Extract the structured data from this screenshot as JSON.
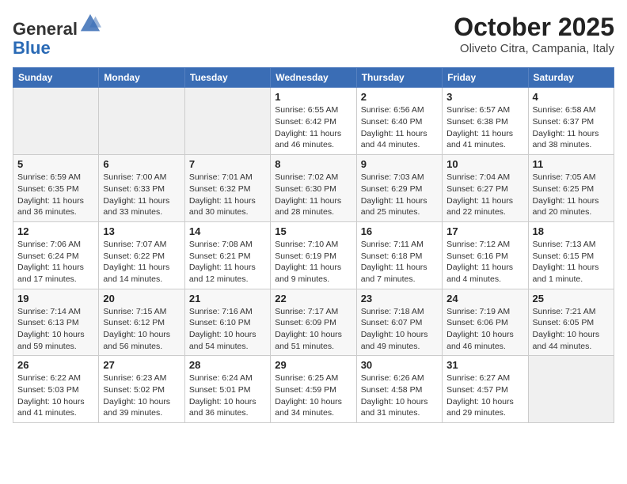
{
  "header": {
    "logo": {
      "general": "General",
      "blue": "Blue",
      "tagline": ""
    },
    "title": "October 2025",
    "location": "Oliveto Citra, Campania, Italy"
  },
  "calendar": {
    "days_of_week": [
      "Sunday",
      "Monday",
      "Tuesday",
      "Wednesday",
      "Thursday",
      "Friday",
      "Saturday"
    ],
    "weeks": [
      [
        {
          "day": "",
          "info": ""
        },
        {
          "day": "",
          "info": ""
        },
        {
          "day": "",
          "info": ""
        },
        {
          "day": "1",
          "info": "Sunrise: 6:55 AM\nSunset: 6:42 PM\nDaylight: 11 hours\nand 46 minutes."
        },
        {
          "day": "2",
          "info": "Sunrise: 6:56 AM\nSunset: 6:40 PM\nDaylight: 11 hours\nand 44 minutes."
        },
        {
          "day": "3",
          "info": "Sunrise: 6:57 AM\nSunset: 6:38 PM\nDaylight: 11 hours\nand 41 minutes."
        },
        {
          "day": "4",
          "info": "Sunrise: 6:58 AM\nSunset: 6:37 PM\nDaylight: 11 hours\nand 38 minutes."
        }
      ],
      [
        {
          "day": "5",
          "info": "Sunrise: 6:59 AM\nSunset: 6:35 PM\nDaylight: 11 hours\nand 36 minutes."
        },
        {
          "day": "6",
          "info": "Sunrise: 7:00 AM\nSunset: 6:33 PM\nDaylight: 11 hours\nand 33 minutes."
        },
        {
          "day": "7",
          "info": "Sunrise: 7:01 AM\nSunset: 6:32 PM\nDaylight: 11 hours\nand 30 minutes."
        },
        {
          "day": "8",
          "info": "Sunrise: 7:02 AM\nSunset: 6:30 PM\nDaylight: 11 hours\nand 28 minutes."
        },
        {
          "day": "9",
          "info": "Sunrise: 7:03 AM\nSunset: 6:29 PM\nDaylight: 11 hours\nand 25 minutes."
        },
        {
          "day": "10",
          "info": "Sunrise: 7:04 AM\nSunset: 6:27 PM\nDaylight: 11 hours\nand 22 minutes."
        },
        {
          "day": "11",
          "info": "Sunrise: 7:05 AM\nSunset: 6:25 PM\nDaylight: 11 hours\nand 20 minutes."
        }
      ],
      [
        {
          "day": "12",
          "info": "Sunrise: 7:06 AM\nSunset: 6:24 PM\nDaylight: 11 hours\nand 17 minutes."
        },
        {
          "day": "13",
          "info": "Sunrise: 7:07 AM\nSunset: 6:22 PM\nDaylight: 11 hours\nand 14 minutes."
        },
        {
          "day": "14",
          "info": "Sunrise: 7:08 AM\nSunset: 6:21 PM\nDaylight: 11 hours\nand 12 minutes."
        },
        {
          "day": "15",
          "info": "Sunrise: 7:10 AM\nSunset: 6:19 PM\nDaylight: 11 hours\nand 9 minutes."
        },
        {
          "day": "16",
          "info": "Sunrise: 7:11 AM\nSunset: 6:18 PM\nDaylight: 11 hours\nand 7 minutes."
        },
        {
          "day": "17",
          "info": "Sunrise: 7:12 AM\nSunset: 6:16 PM\nDaylight: 11 hours\nand 4 minutes."
        },
        {
          "day": "18",
          "info": "Sunrise: 7:13 AM\nSunset: 6:15 PM\nDaylight: 11 hours\nand 1 minute."
        }
      ],
      [
        {
          "day": "19",
          "info": "Sunrise: 7:14 AM\nSunset: 6:13 PM\nDaylight: 10 hours\nand 59 minutes."
        },
        {
          "day": "20",
          "info": "Sunrise: 7:15 AM\nSunset: 6:12 PM\nDaylight: 10 hours\nand 56 minutes."
        },
        {
          "day": "21",
          "info": "Sunrise: 7:16 AM\nSunset: 6:10 PM\nDaylight: 10 hours\nand 54 minutes."
        },
        {
          "day": "22",
          "info": "Sunrise: 7:17 AM\nSunset: 6:09 PM\nDaylight: 10 hours\nand 51 minutes."
        },
        {
          "day": "23",
          "info": "Sunrise: 7:18 AM\nSunset: 6:07 PM\nDaylight: 10 hours\nand 49 minutes."
        },
        {
          "day": "24",
          "info": "Sunrise: 7:19 AM\nSunset: 6:06 PM\nDaylight: 10 hours\nand 46 minutes."
        },
        {
          "day": "25",
          "info": "Sunrise: 7:21 AM\nSunset: 6:05 PM\nDaylight: 10 hours\nand 44 minutes."
        }
      ],
      [
        {
          "day": "26",
          "info": "Sunrise: 6:22 AM\nSunset: 5:03 PM\nDaylight: 10 hours\nand 41 minutes."
        },
        {
          "day": "27",
          "info": "Sunrise: 6:23 AM\nSunset: 5:02 PM\nDaylight: 10 hours\nand 39 minutes."
        },
        {
          "day": "28",
          "info": "Sunrise: 6:24 AM\nSunset: 5:01 PM\nDaylight: 10 hours\nand 36 minutes."
        },
        {
          "day": "29",
          "info": "Sunrise: 6:25 AM\nSunset: 4:59 PM\nDaylight: 10 hours\nand 34 minutes."
        },
        {
          "day": "30",
          "info": "Sunrise: 6:26 AM\nSunset: 4:58 PM\nDaylight: 10 hours\nand 31 minutes."
        },
        {
          "day": "31",
          "info": "Sunrise: 6:27 AM\nSunset: 4:57 PM\nDaylight: 10 hours\nand 29 minutes."
        },
        {
          "day": "",
          "info": ""
        }
      ]
    ]
  }
}
